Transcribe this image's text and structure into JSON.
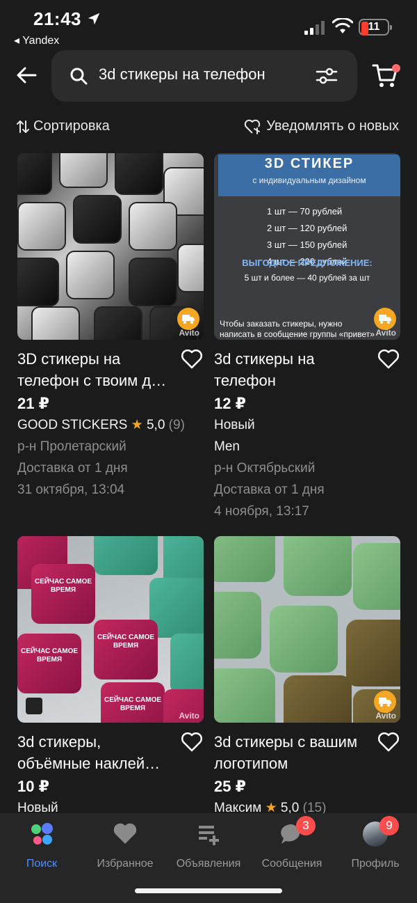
{
  "status_bar": {
    "time": "21:43",
    "back_app": "◂ Yandex",
    "battery": "11"
  },
  "search": {
    "query": "3d стикеры на телефон"
  },
  "toolbar": {
    "sort_label": "Сортировка",
    "notify_label": "Уведомлять о новых"
  },
  "listings": [
    {
      "title": "3D стикеры на телефон с твоим д…",
      "price": "21 ₽",
      "seller": "GOOD STICKERS",
      "rating": "5,0",
      "reviews": "(9)",
      "district": "р-н Пролетарский",
      "delivery": "Доставка от 1 дня",
      "date": "31 октября, 13:04"
    },
    {
      "title": "3d стикеры на телефон",
      "price": "12 ₽",
      "condition": "Новый",
      "seller": "Men",
      "district": "р-н Октябрьский",
      "delivery": "Доставка от 1 дня",
      "date": "4 ноября, 13:17",
      "image_text": {
        "headline": "3D СТИКЕР",
        "subhead": "с индивидуальным дизайном",
        "prices": [
          "1 шт — 70 рублей",
          "2 шт — 120 рублей",
          "3 шт — 150 рублей",
          "4 шт — 220 рублей"
        ],
        "offer": "ВЫГОДНОЕ ПРЕДЛОЖЕНИЕ:",
        "offer_detail": "5 шт и более — 40 рублей за шт",
        "footer": "Чтобы заказать стикеры, нужно написать в сообщение группы «привет»"
      }
    },
    {
      "title": "3d стикеры, объёмные наклей…",
      "price": "10 ₽",
      "condition": "Новый",
      "image_text": {
        "tile": "СЕЙЧАС САМОЕ ВРЕМЯ"
      }
    },
    {
      "title": "3d стикеры с вашим логотипом",
      "price": "25 ₽",
      "seller": "Максим",
      "rating": "5,0",
      "reviews": "(15)"
    }
  ],
  "watermark": "Avito",
  "tabbar": {
    "items": [
      {
        "label": "Поиск",
        "icon": "search-dots-icon",
        "active": true
      },
      {
        "label": "Избранное",
        "icon": "heart-icon"
      },
      {
        "label": "Объявления",
        "icon": "add-listing-icon"
      },
      {
        "label": "Сообщения",
        "icon": "chat-bubble-icon",
        "badge": "3"
      },
      {
        "label": "Профиль",
        "icon": "avatar",
        "badge": "9"
      }
    ]
  },
  "colors": {
    "background": "#1b1b1b",
    "accent": "#4d8eff",
    "badge": "#ff4d4d",
    "star": "#f5a623"
  }
}
